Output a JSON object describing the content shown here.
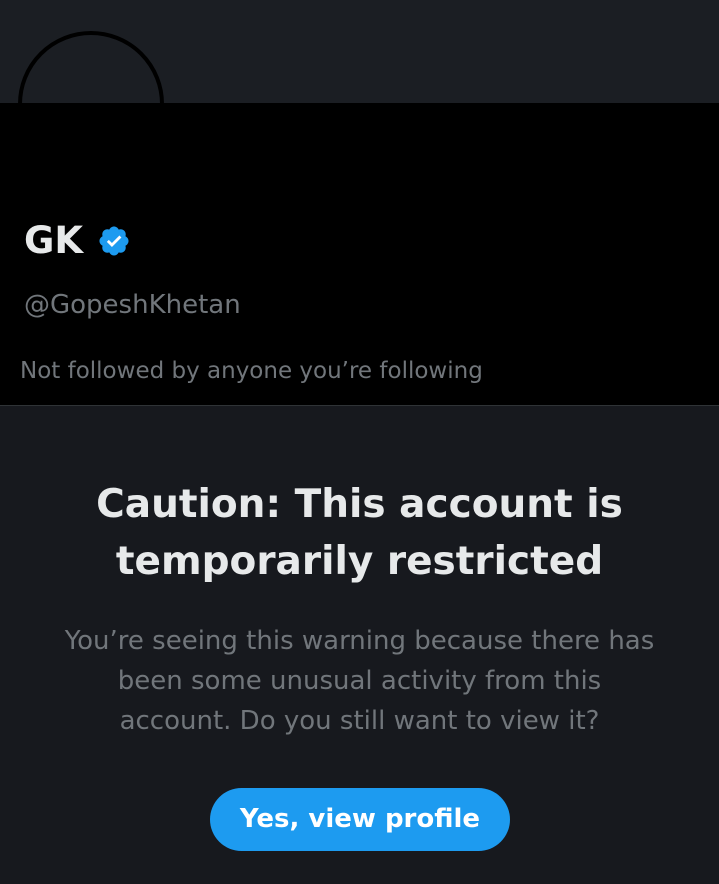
{
  "profile": {
    "display_name": "GK",
    "handle": "@GopeshKhetan",
    "followers_note": "Not followed by anyone you’re following",
    "verified_icon": "verified-badge-icon"
  },
  "warning": {
    "title": "Caution: This account is temporarily restricted",
    "body": "You’re seeing this warning because there has been some unusual activity from this account. Do you still want to view it?",
    "button_label": "Yes, view profile"
  },
  "colors": {
    "accent": "#1d9bf0",
    "background": "#17191e",
    "profile_background": "#000000",
    "primary_text": "#e7e9ea",
    "secondary_text": "#71767b"
  }
}
